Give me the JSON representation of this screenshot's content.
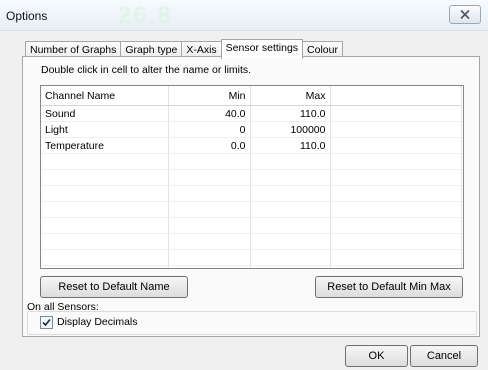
{
  "window": {
    "title": "Options",
    "title_watermark": "26.8"
  },
  "tabs": [
    {
      "label": "Number of Graphs",
      "active": false
    },
    {
      "label": "Graph type",
      "active": false
    },
    {
      "label": "X-Axis",
      "active": false
    },
    {
      "label": "Sensor settings",
      "active": true
    },
    {
      "label": "Colour",
      "active": false
    }
  ],
  "panel": {
    "hint": "Double click in cell to alter the name or limits.",
    "table": {
      "columns": [
        "Channel Name",
        "Min",
        "Max"
      ],
      "rows": [
        {
          "name": "Sound",
          "min": "40.0",
          "max": "110.0"
        },
        {
          "name": "Light",
          "min": "0",
          "max": "100000"
        },
        {
          "name": "Temperature",
          "min": "0.0",
          "max": "110.0"
        }
      ]
    },
    "reset_name_label": "Reset to Default Name",
    "reset_limits_label": "Reset to Default Min  Max",
    "all_sensors_label": "On all Sensors:",
    "display_decimals_label": "Display Decimals",
    "display_decimals_checked": true
  },
  "footer": {
    "ok_label": "OK",
    "cancel_label": "Cancel"
  },
  "icons": {
    "close": "close-icon",
    "check": "checkmark-icon"
  }
}
